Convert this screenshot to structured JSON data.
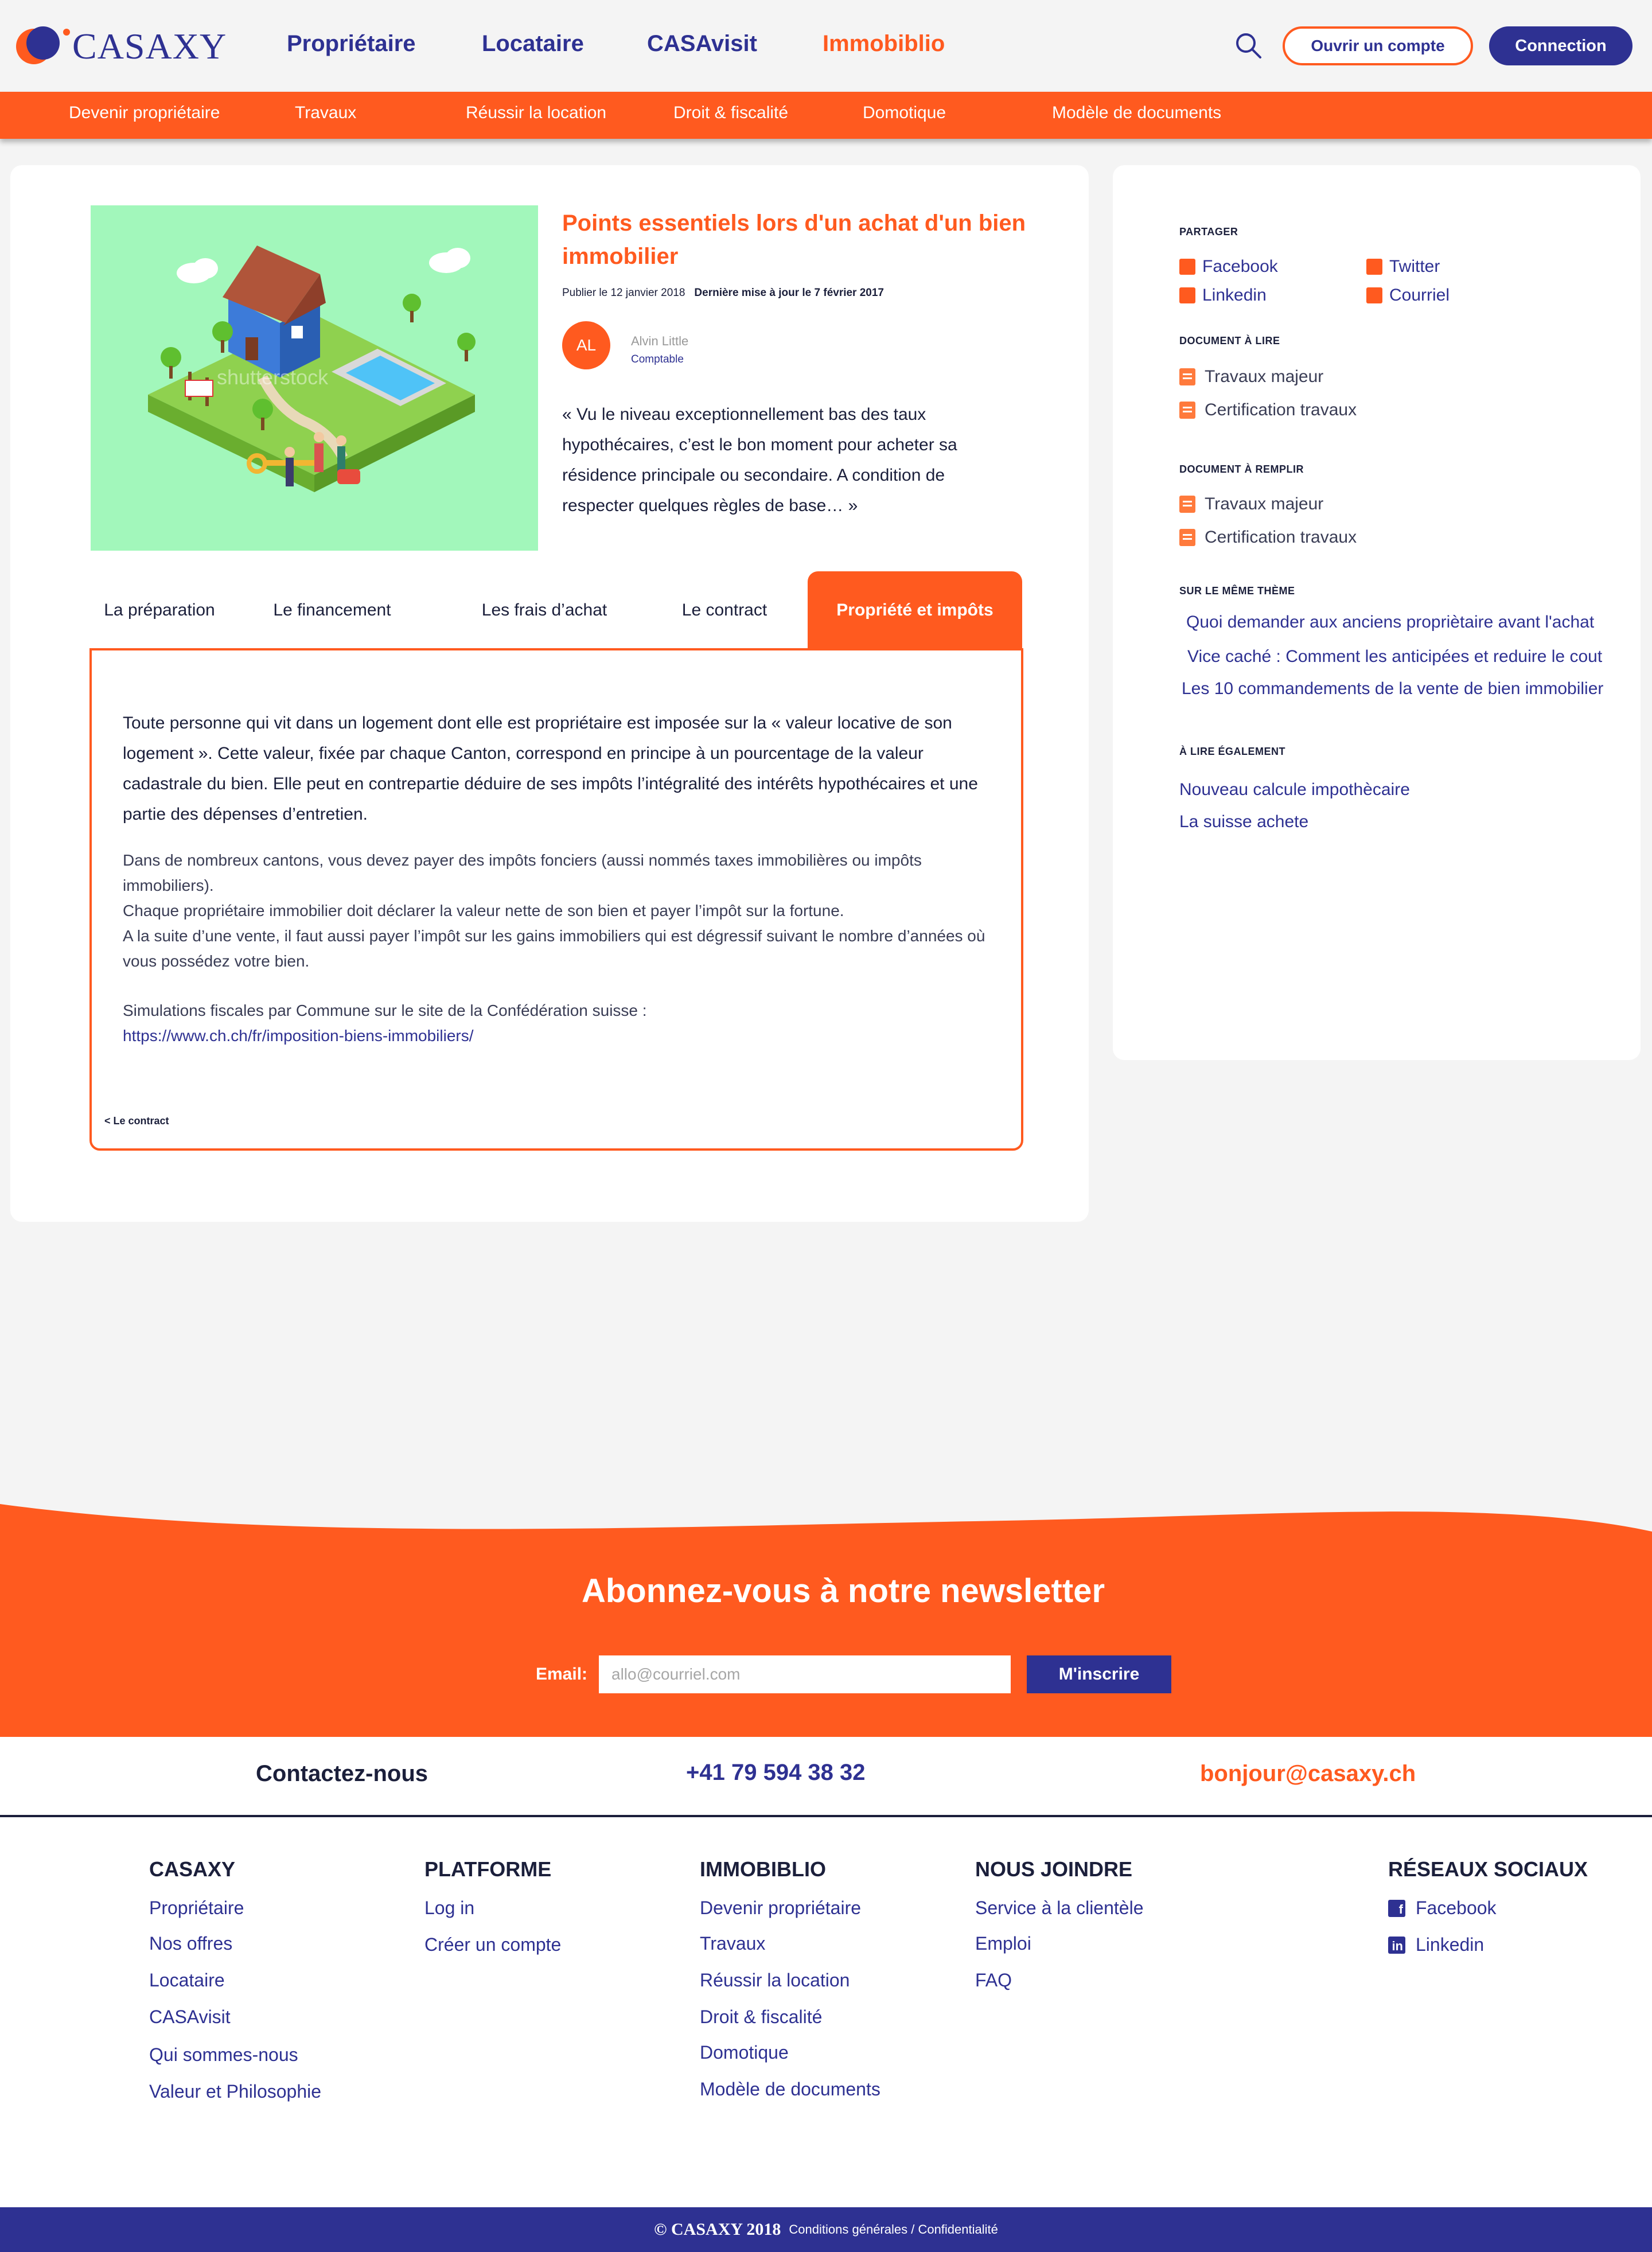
{
  "header": {
    "logo_text": "CASAXY",
    "nav": [
      "Propriétaire",
      "Locataire",
      "CASAvisit",
      "Immobiblio"
    ],
    "active_nav": "Immobiblio",
    "open_account": "Ouvrir un compte",
    "login": "Connection"
  },
  "subnav": [
    "Devenir propriétaire",
    "Travaux",
    "Réussir la location",
    "Droit & fiscalité",
    "Domotique",
    "Modèle de documents"
  ],
  "article": {
    "title": "Points essentiels lors d'un achat d'un bien immobilier",
    "published": "Publier le 12 janvier 2018",
    "updated": "Dernière mise à jour le 7 février 2017",
    "author_initials": "AL",
    "author_name": "Alvin Little",
    "author_role": "Comptable",
    "quote": "« Vu le niveau exceptionnellement bas des taux hypothécaires, c’est le bon moment pour acheter sa résidence principale ou secondaire. A condition de respecter quelques règles de base… »",
    "image_watermark": "shutterstock",
    "tabs": [
      "La préparation",
      "Le financement",
      "Les frais d’achat",
      "Le contract",
      "Propriété et impôts"
    ],
    "active_tab": "Propriété et impôts",
    "panel": {
      "p1": "Toute personne qui vit dans un logement dont elle est propriétaire est imposée sur la «  valeur locative de son logement  ». Cette valeur, fixée par chaque Canton, correspond en principe à un pourcentage de la valeur cadastrale du bien. Elle peut en contrepartie déduire de ses impôts l’intégralité des intérêts hypothécaires et une partie des dépenses d’entretien.",
      "p2a": "Dans de nombreux cantons, vous devez payer des impôts fonciers (aussi nommés taxes immobilières ou impôts immobiliers).",
      "p2b": "Chaque propriétaire immobilier doit déclarer la valeur nette de son bien et payer l’impôt sur la fortune.",
      "p2c": "A la suite d’une vente, il faut aussi payer l’impôt sur les gains immobiliers qui est dégressif suivant le nombre d’années où vous possédez votre bien.",
      "p3": "Simulations fiscales par Commune sur  le site de la Confédération suisse :",
      "p3_link": "https://www.ch.ch/fr/imposition-biens-immobiliers/",
      "back": "< Le contract"
    }
  },
  "sidebar": {
    "share_title": "PARTAGER",
    "share": [
      "Facebook",
      "Twitter",
      "Linkedin",
      "Courriel"
    ],
    "read_title": "DOCUMENT À LIRE",
    "read": [
      "Travaux majeur",
      "Certification travaux"
    ],
    "fill_title": "DOCUMENT À REMPLIR",
    "fill": [
      "Travaux majeur",
      "Certification travaux"
    ],
    "theme_title": "SUR LE MÊME THÈME",
    "theme": [
      "Quoi demander aux anciens propriètaire avant l'achat",
      "Vice caché : Comment les anticipées et reduire le cout",
      "Les 10 commandements de la vente de bien immobilier"
    ],
    "also_title": "À LIRE ÉGALEMENT",
    "also": [
      "Nouveau calcule impothècaire",
      "La suisse achete"
    ]
  },
  "newsletter": {
    "title": "Abonnez-vous à notre newsletter",
    "email_label": "Email:",
    "email_placeholder": "allo@courriel.com",
    "button": "M'inscrire"
  },
  "contact": {
    "title": "Contactez-nous",
    "phone": "+41 79 594 38 32",
    "email": "bonjour@casaxy.ch"
  },
  "footer": {
    "col1": {
      "title": "CASAXY",
      "links": [
        "Propriétaire",
        "Nos offres",
        "Locataire",
        "CASAvisit",
        "Qui sommes-nous",
        "Valeur et Philosophie"
      ]
    },
    "col2": {
      "title": "PLATFORME",
      "links": [
        "Log in",
        "Créer un compte"
      ]
    },
    "col3": {
      "title": "IMMOBIBLIO",
      "links": [
        "Devenir propriétaire",
        "Travaux",
        "Réussir la location",
        "Droit & fiscalité",
        "Domotique",
        "Modèle de documents"
      ]
    },
    "col4": {
      "title": "NOUS JOINDRE",
      "links": [
        "Service à la clientèle",
        "Emploi",
        "FAQ"
      ]
    },
    "col5": {
      "title": "RÉSEAUX SOCIAUX",
      "links": [
        "Facebook",
        "Linkedin"
      ]
    },
    "copyright": "© CASAXY 2018",
    "legal": "Conditions générales / Confidentialité"
  },
  "colors": {
    "orange": "#ff5a1f",
    "navy": "#2e3192",
    "hero_bg": "#a2f7bb",
    "page_bg": "#f4f4f4"
  }
}
